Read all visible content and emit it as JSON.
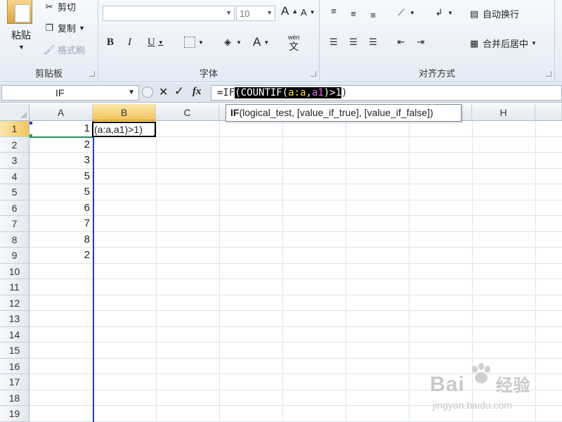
{
  "ribbon": {
    "clipboard": {
      "paste_label": "粘贴",
      "cut_label": "剪切",
      "copy_label": "复制",
      "format_painter_label": "格式刷",
      "group_title": "剪贴板"
    },
    "font": {
      "font_name_value": "",
      "font_size_value": "10",
      "bold": "B",
      "italic": "I",
      "underline": "U",
      "grow": "A",
      "shrink": "A",
      "font_color": "A",
      "wen": "wén",
      "wen_char": "文",
      "group_title": "字体"
    },
    "alignment": {
      "wrap_text_label": "自动换行",
      "merge_center_label": "合并后居中",
      "group_title": "对齐方式"
    }
  },
  "formula_bar": {
    "name_box_value": "IF",
    "cancel_icon": "✕",
    "enter_icon": "✓",
    "fx_label": "fx",
    "formula_prefix": "=IF",
    "formula_open": "(COUNTIF(",
    "formula_range": "a:a",
    "formula_comma": ",",
    "formula_crit": "a1",
    "formula_close": ")>1",
    "formula_tail": ")"
  },
  "tooltip": {
    "func": "IF",
    "args": "(logical_test, [value_if_true], [value_if_false])"
  },
  "sheet": {
    "columns": [
      "A",
      "B",
      "C",
      "H"
    ],
    "rows": [
      "1",
      "2",
      "3",
      "4",
      "5",
      "6",
      "7",
      "8",
      "9",
      "10",
      "11",
      "12",
      "13",
      "14",
      "15",
      "16",
      "17",
      "18",
      "19"
    ],
    "column_a_values": [
      "1",
      "2",
      "3",
      "5",
      "5",
      "6",
      "7",
      "8",
      "2"
    ],
    "edit_cell_text": "(a:a,a1)>1)"
  },
  "watermark": {
    "line1": "Bai",
    "line1b": "经验",
    "line2": "jingyan.baidu.com"
  },
  "colors": {
    "ref_blue": "#1f3fbf",
    "active_header": "#f3c65e",
    "highlight_yellow": "#ffd84a",
    "highlight_magenta": "#e26be0"
  }
}
